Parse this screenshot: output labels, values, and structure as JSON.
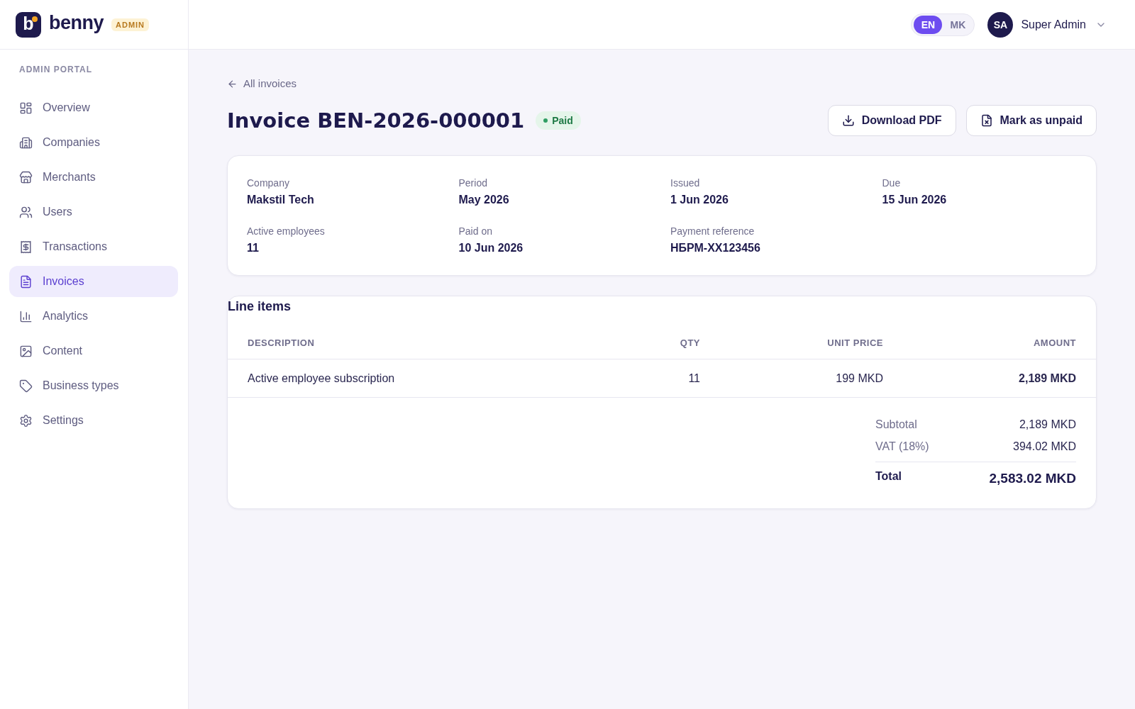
{
  "brand": {
    "letter": "b",
    "name": "benny",
    "badge": "ADMIN"
  },
  "sidebar": {
    "section": "ADMIN PORTAL",
    "items": [
      {
        "label": "Overview",
        "selected": false
      },
      {
        "label": "Companies",
        "selected": false
      },
      {
        "label": "Merchants",
        "selected": false
      },
      {
        "label": "Users",
        "selected": false
      },
      {
        "label": "Transactions",
        "selected": false
      },
      {
        "label": "Invoices",
        "selected": true
      },
      {
        "label": "Analytics",
        "selected": false
      },
      {
        "label": "Content",
        "selected": false
      },
      {
        "label": "Business types",
        "selected": false
      },
      {
        "label": "Settings",
        "selected": false
      }
    ]
  },
  "header": {
    "languages": [
      {
        "label": "EN",
        "selected": true
      },
      {
        "label": "MK",
        "selected": false
      }
    ],
    "user": {
      "initials": "SA",
      "name": "Super Admin"
    }
  },
  "page": {
    "back_link": "All invoices",
    "title": "Invoice BEN-2026-000001",
    "status": {
      "label": "Paid",
      "paid": true
    },
    "actions": [
      "Download PDF",
      "Mark as unpaid"
    ]
  },
  "details": [
    {
      "label": "Company",
      "value": "Makstil Tech"
    },
    {
      "label": "Period",
      "value": "May 2026"
    },
    {
      "label": "Issued",
      "value": "1 Jun 2026"
    },
    {
      "label": "Due",
      "value": "15 Jun 2026"
    },
    {
      "label": "Active employees",
      "value": "11"
    },
    {
      "label": "Paid on",
      "value": "10 Jun 2026"
    },
    {
      "label": "Payment reference",
      "value": "НБРМ-XX123456"
    }
  ],
  "line_items": {
    "title": "Line items",
    "columns": [
      "DESCRIPTION",
      "QTY",
      "UNIT PRICE",
      "AMOUNT"
    ],
    "rows": [
      [
        "Active employee subscription",
        "11",
        "199 MKD",
        "2,189 MKD"
      ]
    ],
    "totals": [
      {
        "kind": "line",
        "label": "Subtotal",
        "value": "2,189 MKD"
      },
      {
        "kind": "line",
        "label": "VAT (18%)",
        "value": "394.02 MKD"
      },
      {
        "kind": "total",
        "label": "Total",
        "value": "2,583.02 MKD"
      }
    ]
  }
}
